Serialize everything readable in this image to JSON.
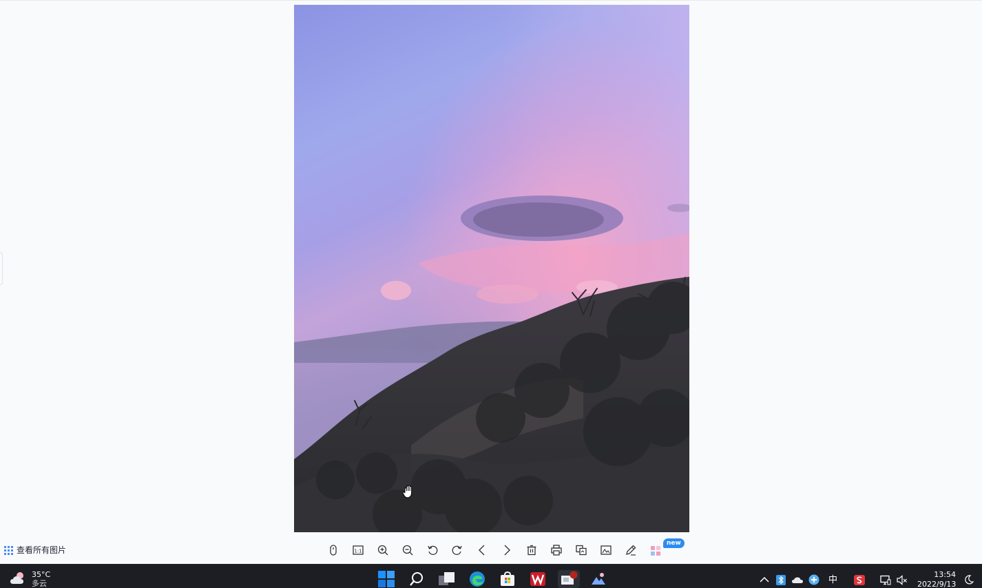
{
  "viewer": {
    "view_all_label": "查看所有图片",
    "photo_alt": "sunset mountain landscape",
    "badge_new": "new",
    "toolbar_icons": [
      "mouse-icon",
      "actual-size-icon",
      "zoom-in-icon",
      "zoom-out-icon",
      "rotate-left-icon",
      "rotate-right-icon",
      "previous-icon",
      "next-icon",
      "delete-icon",
      "print-icon",
      "convert-icon",
      "image-edit-icon",
      "edit-icon",
      "more-apps-icon"
    ]
  },
  "taskbar": {
    "weather_temp": "35°C",
    "weather_condition": "多云",
    "apps": [
      "start",
      "search",
      "task-view",
      "edge",
      "store",
      "wps",
      "image-viewer",
      "photos"
    ],
    "ime_label": "中",
    "time": "13:54",
    "date": "2022/9/13"
  },
  "colors": {
    "accent": "#2d8cf0",
    "taskbar_bg": "#1c1e24",
    "viewer_bg": "#f9fafc"
  }
}
